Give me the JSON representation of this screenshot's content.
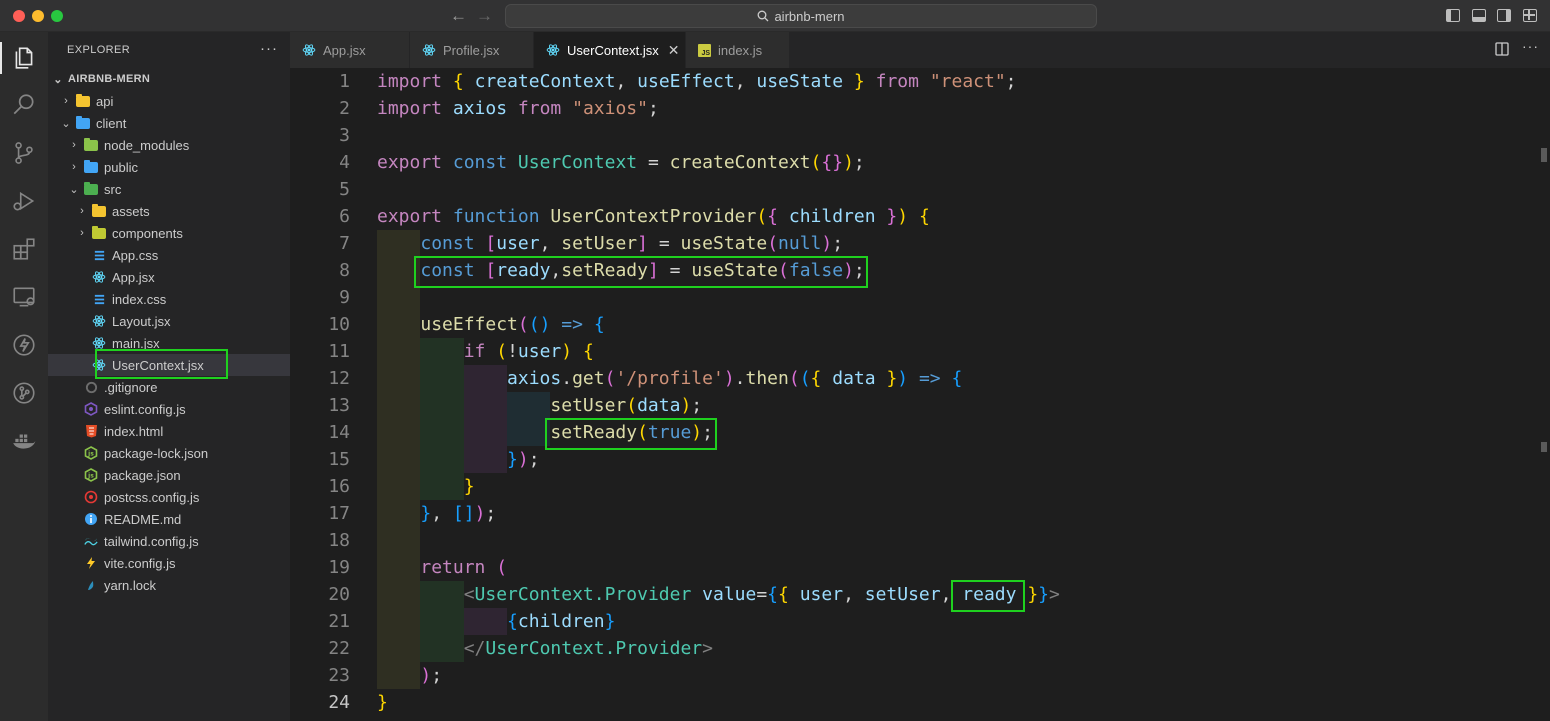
{
  "window": {
    "title": "airbnb-mern"
  },
  "colors": {
    "highlight": "#1fd11f",
    "accent": "#007acc"
  },
  "sidebar": {
    "header": "EXPLORER",
    "more": "···",
    "root": "AIRBNB-MERN",
    "items": [
      {
        "label": "api",
        "icon": "folder-icon",
        "depth": 1,
        "chev": "›"
      },
      {
        "label": "client",
        "icon": "folder-icon",
        "depth": 1,
        "chev": "⌄"
      },
      {
        "label": "node_modules",
        "icon": "folder-icon",
        "depth": 2,
        "chev": "›"
      },
      {
        "label": "public",
        "icon": "folder-icon",
        "depth": 2,
        "chev": "›"
      },
      {
        "label": "src",
        "icon": "folder-icon",
        "depth": 2,
        "chev": "⌄"
      },
      {
        "label": "assets",
        "icon": "folder-icon",
        "depth": 3,
        "chev": "›"
      },
      {
        "label": "components",
        "icon": "folder-icon",
        "depth": 3,
        "chev": "›"
      },
      {
        "label": "App.css",
        "icon": "css-icon",
        "depth": 3,
        "chev": ""
      },
      {
        "label": "App.jsx",
        "icon": "react-icon",
        "depth": 3,
        "chev": ""
      },
      {
        "label": "index.css",
        "icon": "css-icon",
        "depth": 3,
        "chev": ""
      },
      {
        "label": "Layout.jsx",
        "icon": "react-icon",
        "depth": 3,
        "chev": ""
      },
      {
        "label": "main.jsx",
        "icon": "react-icon",
        "depth": 3,
        "chev": ""
      },
      {
        "label": "UserContext.jsx",
        "icon": "react-icon",
        "depth": 3,
        "chev": ""
      },
      {
        "label": ".gitignore",
        "icon": "git-icon",
        "depth": 2,
        "chev": ""
      },
      {
        "label": "eslint.config.js",
        "icon": "eslint-icon",
        "depth": 2,
        "chev": ""
      },
      {
        "label": "index.html",
        "icon": "html-icon",
        "depth": 2,
        "chev": ""
      },
      {
        "label": "package-lock.json",
        "icon": "node-icon",
        "depth": 2,
        "chev": ""
      },
      {
        "label": "package.json",
        "icon": "node-icon",
        "depth": 2,
        "chev": ""
      },
      {
        "label": "postcss.config.js",
        "icon": "postcss-icon",
        "depth": 2,
        "chev": ""
      },
      {
        "label": "README.md",
        "icon": "info-icon",
        "depth": 2,
        "chev": ""
      },
      {
        "label": "tailwind.config.js",
        "icon": "tailwind-icon",
        "depth": 2,
        "chev": ""
      },
      {
        "label": "vite.config.js",
        "icon": "vite-icon",
        "depth": 2,
        "chev": ""
      },
      {
        "label": "yarn.lock",
        "icon": "yarn-icon",
        "depth": 2,
        "chev": ""
      }
    ]
  },
  "tabs": [
    {
      "label": "App.jsx",
      "icon": "react-icon"
    },
    {
      "label": "Profile.jsx",
      "icon": "react-icon"
    },
    {
      "label": "UserContext.jsx",
      "icon": "react-icon",
      "close": "✕"
    },
    {
      "label": "index.js",
      "icon": "js-icon",
      "badge": "JS"
    }
  ],
  "editor": {
    "line_numbers": [
      "1",
      "2",
      "3",
      "4",
      "5",
      "6",
      "7",
      "8",
      "9",
      "10",
      "11",
      "12",
      "13",
      "14",
      "15",
      "16",
      "17",
      "18",
      "19",
      "20",
      "21",
      "22",
      "23",
      "24"
    ],
    "lines": [
      [
        [
          "kw",
          "import"
        ],
        [
          "txt",
          " "
        ],
        [
          "br1",
          "{"
        ],
        [
          "txt",
          " "
        ],
        [
          "var",
          "createContext"
        ],
        [
          "txt",
          ", "
        ],
        [
          "var",
          "useEffect"
        ],
        [
          "txt",
          ", "
        ],
        [
          "var",
          "useState"
        ],
        [
          "txt",
          " "
        ],
        [
          "br1",
          "}"
        ],
        [
          "txt",
          " "
        ],
        [
          "kw",
          "from"
        ],
        [
          "txt",
          " "
        ],
        [
          "str",
          "\"react\""
        ],
        [
          "txt",
          ";"
        ]
      ],
      [
        [
          "kw",
          "import"
        ],
        [
          "txt",
          " "
        ],
        [
          "var",
          "axios"
        ],
        [
          "txt",
          " "
        ],
        [
          "kw",
          "from"
        ],
        [
          "txt",
          " "
        ],
        [
          "str",
          "\"axios\""
        ],
        [
          "txt",
          ";"
        ]
      ],
      [],
      [
        [
          "kw",
          "export"
        ],
        [
          "txt",
          " "
        ],
        [
          "kw2",
          "const"
        ],
        [
          "txt",
          " "
        ],
        [
          "typ",
          "UserContext"
        ],
        [
          "txt",
          " = "
        ],
        [
          "fn",
          "createContext"
        ],
        [
          "br1",
          "("
        ],
        [
          "br2",
          "{}"
        ],
        [
          "br1",
          ")"
        ],
        [
          "txt",
          ";"
        ]
      ],
      [],
      [
        [
          "kw",
          "export"
        ],
        [
          "txt",
          " "
        ],
        [
          "kw2",
          "function"
        ],
        [
          "txt",
          " "
        ],
        [
          "fn",
          "UserContextProvider"
        ],
        [
          "br1",
          "("
        ],
        [
          "br2",
          "{"
        ],
        [
          "txt",
          " "
        ],
        [
          "var",
          "children"
        ],
        [
          "txt",
          " "
        ],
        [
          "br2",
          "}"
        ],
        [
          "br1",
          ")"
        ],
        [
          "txt",
          " "
        ],
        [
          "br1",
          "{"
        ]
      ],
      [
        [
          "txt",
          "    "
        ],
        [
          "kw2",
          "const"
        ],
        [
          "txt",
          " "
        ],
        [
          "br2",
          "["
        ],
        [
          "var",
          "user"
        ],
        [
          "txt",
          ", "
        ],
        [
          "fn",
          "setUser"
        ],
        [
          "br2",
          "]"
        ],
        [
          "txt",
          " = "
        ],
        [
          "fn",
          "useState"
        ],
        [
          "br2",
          "("
        ],
        [
          "kw2",
          "null"
        ],
        [
          "br2",
          ")"
        ],
        [
          "txt",
          ";"
        ]
      ],
      [
        [
          "txt",
          "    "
        ],
        [
          "kw2",
          "const"
        ],
        [
          "txt",
          " "
        ],
        [
          "br2",
          "["
        ],
        [
          "var",
          "ready"
        ],
        [
          "txt",
          ","
        ],
        [
          "fn",
          "setReady"
        ],
        [
          "br2",
          "]"
        ],
        [
          "txt",
          " = "
        ],
        [
          "fn",
          "useState"
        ],
        [
          "br2",
          "("
        ],
        [
          "kw2",
          "false"
        ],
        [
          "br2",
          ")"
        ],
        [
          "txt",
          ";"
        ]
      ],
      [],
      [
        [
          "txt",
          "    "
        ],
        [
          "fn",
          "useEffect"
        ],
        [
          "br2",
          "("
        ],
        [
          "br3",
          "()"
        ],
        [
          "txt",
          " "
        ],
        [
          "kw2",
          "=>"
        ],
        [
          "txt",
          " "
        ],
        [
          "br3",
          "{"
        ]
      ],
      [
        [
          "txt",
          "        "
        ],
        [
          "kw",
          "if"
        ],
        [
          "txt",
          " "
        ],
        [
          "br1",
          "("
        ],
        [
          "txt",
          "!"
        ],
        [
          "var",
          "user"
        ],
        [
          "br1",
          ")"
        ],
        [
          "txt",
          " "
        ],
        [
          "br1",
          "{"
        ]
      ],
      [
        [
          "txt",
          "            "
        ],
        [
          "var",
          "axios"
        ],
        [
          "txt",
          "."
        ],
        [
          "fn",
          "get"
        ],
        [
          "br2",
          "("
        ],
        [
          "str",
          "'/profile'"
        ],
        [
          "br2",
          ")"
        ],
        [
          "txt",
          "."
        ],
        [
          "fn",
          "then"
        ],
        [
          "br2",
          "("
        ],
        [
          "br3",
          "("
        ],
        [
          "br1",
          "{"
        ],
        [
          "txt",
          " "
        ],
        [
          "var",
          "data"
        ],
        [
          "txt",
          " "
        ],
        [
          "br1",
          "}"
        ],
        [
          "br3",
          ")"
        ],
        [
          "txt",
          " "
        ],
        [
          "kw2",
          "=>"
        ],
        [
          "txt",
          " "
        ],
        [
          "br3",
          "{"
        ]
      ],
      [
        [
          "txt",
          "                "
        ],
        [
          "fn",
          "setUser"
        ],
        [
          "br1",
          "("
        ],
        [
          "var",
          "data"
        ],
        [
          "br1",
          ")"
        ],
        [
          "txt",
          ";"
        ]
      ],
      [
        [
          "txt",
          "                "
        ],
        [
          "fn",
          "setReady"
        ],
        [
          "br1",
          "("
        ],
        [
          "kw2",
          "true"
        ],
        [
          "br1",
          ")"
        ],
        [
          "txt",
          ";"
        ]
      ],
      [
        [
          "txt",
          "            "
        ],
        [
          "br3",
          "}"
        ],
        [
          "br2",
          ")"
        ],
        [
          "txt",
          ";"
        ]
      ],
      [
        [
          "txt",
          "        "
        ],
        [
          "br1",
          "}"
        ]
      ],
      [
        [
          "txt",
          "    "
        ],
        [
          "br3",
          "}"
        ],
        [
          "txt",
          ", "
        ],
        [
          "br3",
          "[]"
        ],
        [
          "br2",
          ")"
        ],
        [
          "txt",
          ";"
        ]
      ],
      [],
      [
        [
          "txt",
          "    "
        ],
        [
          "kw",
          "return"
        ],
        [
          "txt",
          " "
        ],
        [
          "br2",
          "("
        ]
      ],
      [
        [
          "txt",
          "        "
        ],
        [
          "tag",
          "<"
        ],
        [
          "typ",
          "UserContext.Provider"
        ],
        [
          "txt",
          " "
        ],
        [
          "var",
          "value"
        ],
        [
          "txt",
          "="
        ],
        [
          "br3",
          "{"
        ],
        [
          "br1",
          "{"
        ],
        [
          "txt",
          " "
        ],
        [
          "var",
          "user"
        ],
        [
          "txt",
          ", "
        ],
        [
          "var",
          "setUser"
        ],
        [
          "txt",
          ", "
        ],
        [
          "var",
          "ready"
        ],
        [
          "txt",
          " "
        ],
        [
          "br1",
          "}"
        ],
        [
          "br3",
          "}"
        ],
        [
          "tag",
          ">"
        ]
      ],
      [
        [
          "txt",
          "            "
        ],
        [
          "br3",
          "{"
        ],
        [
          "var",
          "children"
        ],
        [
          "br3",
          "}"
        ]
      ],
      [
        [
          "txt",
          "        "
        ],
        [
          "tag",
          "</"
        ],
        [
          "typ",
          "UserContext.Provider"
        ],
        [
          "tag",
          ">"
        ]
      ],
      [
        [
          "txt",
          "    "
        ],
        [
          "br2",
          ")"
        ],
        [
          "txt",
          ";"
        ]
      ],
      [
        [
          "br1",
          "}"
        ]
      ]
    ]
  }
}
